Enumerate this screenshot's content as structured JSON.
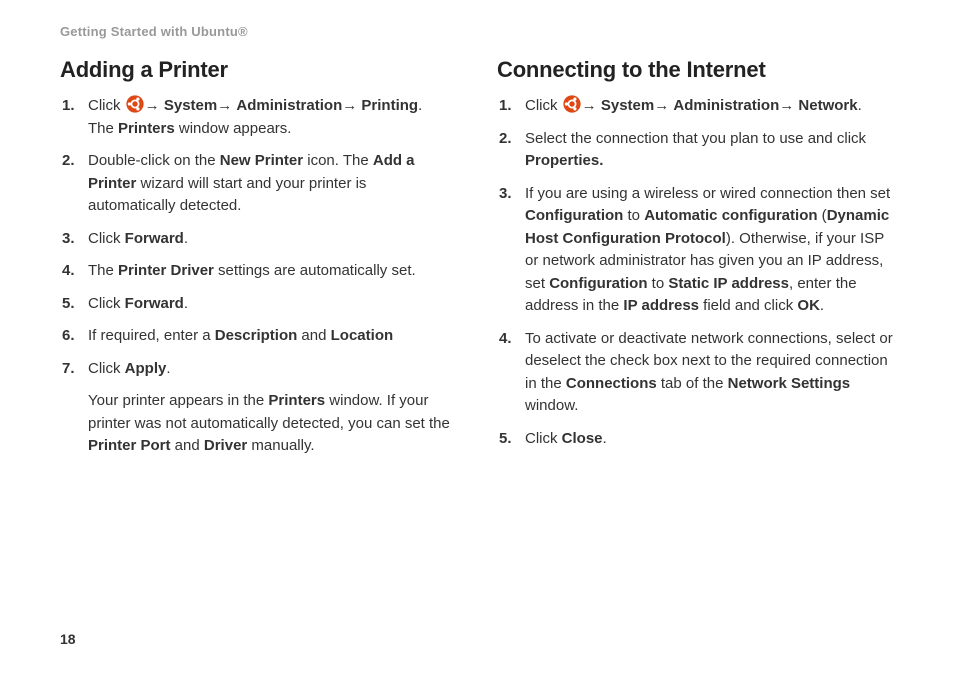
{
  "header": "Getting Started with Ubuntu®",
  "pageNumber": "18",
  "left": {
    "heading": "Adding a Printer",
    "items": [
      {
        "pre": "Click ",
        "iconName": "ubuntu-logo-icon",
        "nav": "→ System→ Administration→ Printing",
        "postBold": ".",
        "extra": "The Printers window appears.",
        "extraBold1": "Printers",
        "extraPre": "The ",
        "extraPost": " window appears."
      },
      {
        "html": "Double-click on the <b>New Printer</b> icon. The <b>Add a Printer</b> wizard will start and your printer is automatically detected."
      },
      {
        "html": "Click <b>Forward</b>."
      },
      {
        "html": "The <b>Printer Driver</b> settings are automatically set."
      },
      {
        "html": "Click <b>Forward</b>."
      },
      {
        "html": "If required, enter a <b>Description</b> and <b>Location</b>"
      },
      {
        "html": "Click <b>Apply</b>."
      }
    ],
    "footnote": "Your printer appears in the <b>Printers</b> window. If your printer was not automatically detected, you can set the <b>Printer Port</b> and <b>Driver</b> manually."
  },
  "right": {
    "heading": "Connecting to the Internet",
    "items": [
      {
        "pre": "Click ",
        "iconName": "ubuntu-logo-icon",
        "nav": "→ System→ Administration→ Network",
        "postBold": "."
      },
      {
        "html": "Select the connection that you plan to use and click <b>Properties.</b>"
      },
      {
        "html": "If you are using a wireless or wired connection then set <b>Configuration</b> to <b>Automatic configuration</b> (<b>Dynamic Host Configuration Protocol</b>). Otherwise, if your ISP or network administrator has given you an IP address, set <b>Configuration</b> to <b>Static IP address</b>, enter the address in the <b>IP address</b> field and click <b>OK</b>."
      },
      {
        "html": "To activate or deactivate network connections, select or deselect the check box next to the required connection in the <b>Connections</b> tab of the <b>Network Settings</b> window."
      },
      {
        "html": "Click <b>Close</b>."
      }
    ]
  },
  "navParts": {
    "arrow": "→ ",
    "system": "System",
    "admin": "Administration",
    "leftEnd": "Printing",
    "rightEnd": "Network"
  }
}
